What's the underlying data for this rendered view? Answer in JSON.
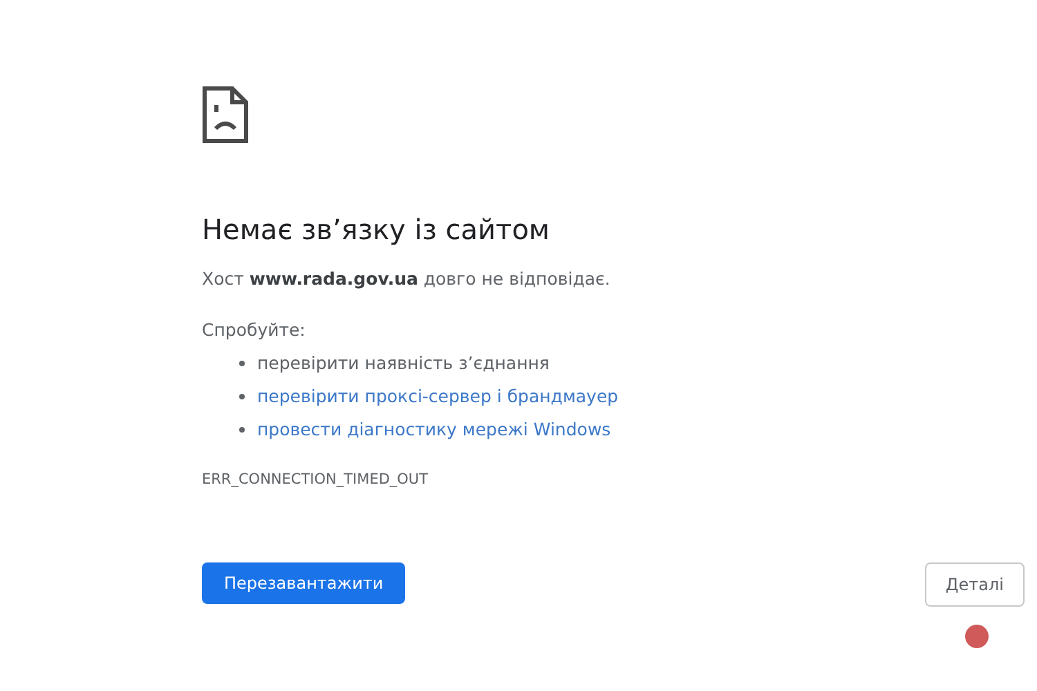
{
  "error_page": {
    "heading": "Немає зв’язку із сайтом",
    "host_message": "Хост **www.rada.gov.ua** довго не відповідає.",
    "suggestions_label": "Спробуйте:",
    "suggestions": [
      {
        "text": "перевірити наявність з’єднання",
        "kind": "text"
      },
      {
        "text": "перевірити проксі-сервер і брандмауер",
        "kind": "link"
      },
      {
        "text": "провести діагностику мережі Windows",
        "kind": "link"
      }
    ],
    "error_code": "ERR_CONNECTION_TIMED_OUT",
    "reload_button": "Перезавантажити",
    "details_button": "Деталі"
  }
}
